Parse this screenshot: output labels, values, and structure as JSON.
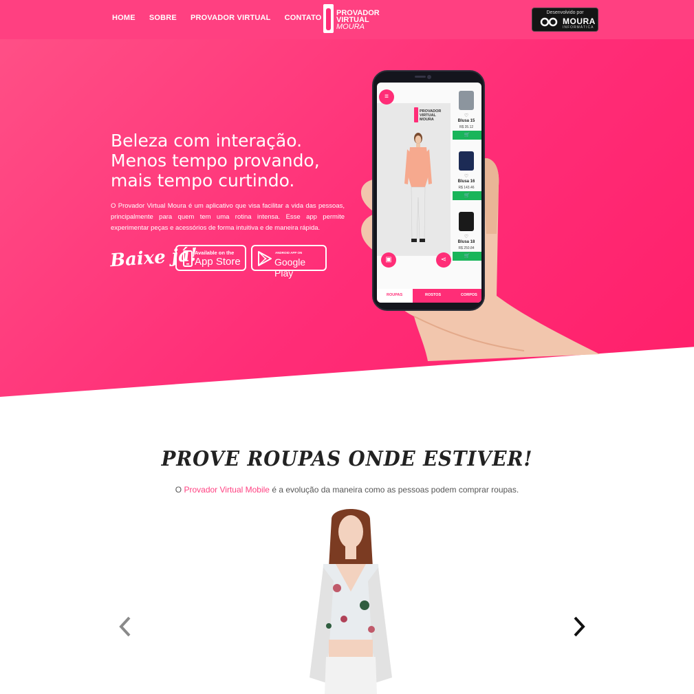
{
  "nav": {
    "items": [
      "HOME",
      "SOBRE",
      "PROVADOR VIRTUAL",
      "CONTATO"
    ]
  },
  "brand": {
    "line1": "Provador",
    "line2": "Virtual",
    "line3": "Moura"
  },
  "developer_badge": {
    "label": "Desenvolvido por",
    "name": "MOURA",
    "sub": "INFORMÁTICA"
  },
  "hero": {
    "title": "Beleza com interação. Menos tempo provando, mais tempo curtindo.",
    "description": "O Provador Virtual Moura é um aplicativo que visa facilitar a vida das pessoas, principalmente para quem tem uma rotina intensa. Esse app permite experimentar peças e acessórios de forma intuitiva e de maneira rápida.",
    "download_label": "Baixe já!",
    "app_store": {
      "small": "Available on the",
      "big": "App Store"
    },
    "google_play": {
      "small": "ANDROID APP ON",
      "big": "Google Play"
    }
  },
  "phone": {
    "logo": {
      "line1": "Provador",
      "line2": "Virtual",
      "line3": "Moura"
    },
    "products": [
      {
        "name": "Blusa 15",
        "price": "R$ 35.12",
        "color": "#8c959e"
      },
      {
        "name": "Blusa 16",
        "price": "R$ 143.46",
        "color": "#1c2b55"
      },
      {
        "name": "Blusa 18",
        "price": "R$ 250.84",
        "color": "#1a1a1a"
      }
    ],
    "tabs": [
      "ROUPAS",
      "ROSTOS",
      "CORPOS"
    ]
  },
  "section": {
    "title": "Prove roupas onde estiver!",
    "sub_prefix": "O ",
    "sub_highlight": "Provador Virtual Mobile",
    "sub_suffix": " é a evolução da maneira como as pessoas podem comprar roupas."
  },
  "colors": {
    "brand_pink": "#ff4081",
    "hero_pink": "#ff2d77",
    "cart_green": "#19b55a"
  }
}
